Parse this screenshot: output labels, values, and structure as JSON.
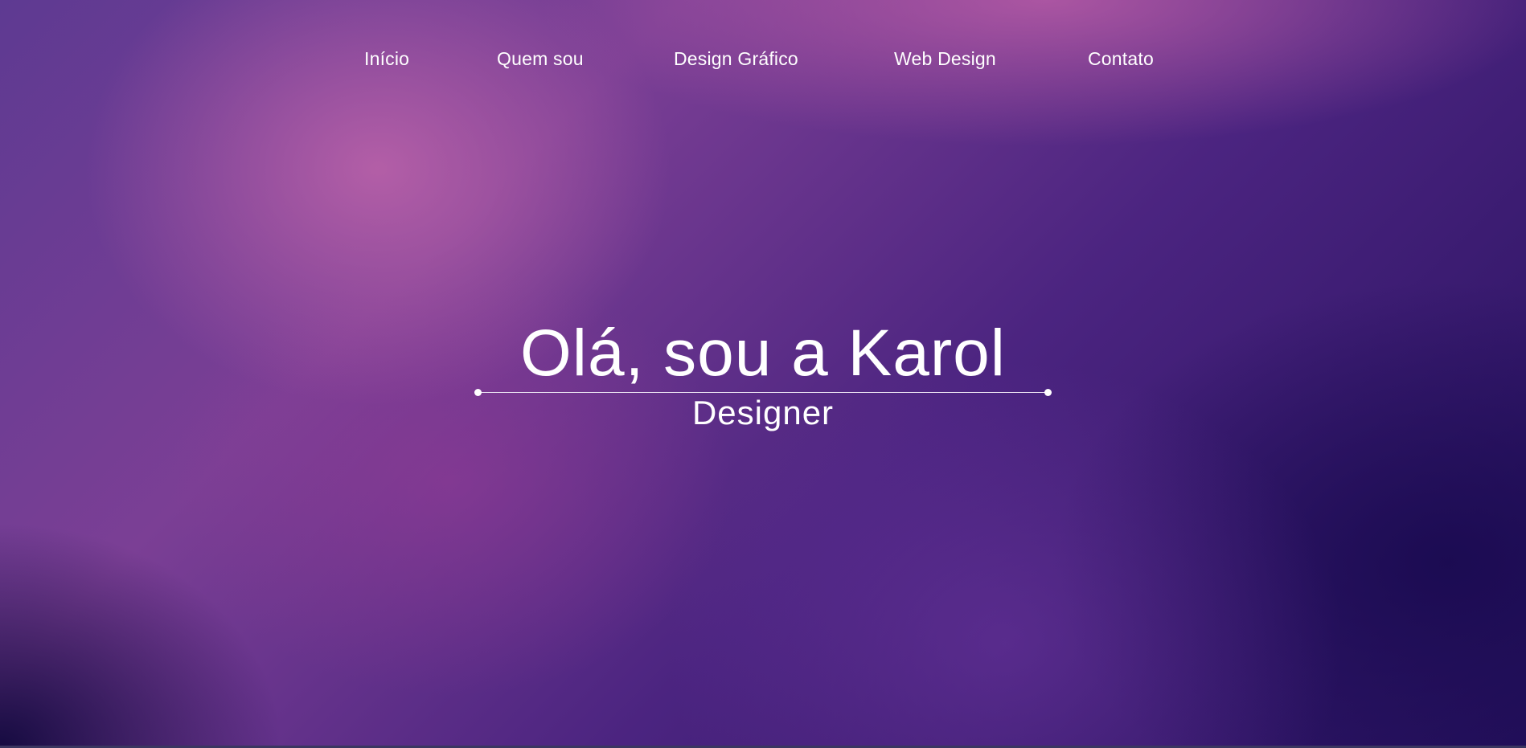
{
  "nav": {
    "items": [
      {
        "label": "Início"
      },
      {
        "label": "Quem sou"
      },
      {
        "label": "Design Gráfico"
      },
      {
        "label": "Web Design"
      },
      {
        "label": "Contato"
      }
    ]
  },
  "hero": {
    "title": "Olá, sou a Karol",
    "subtitle": "Designer"
  },
  "colors": {
    "text": "#ffffff",
    "background_dark": "#24105c",
    "background_accent": "#b862a8"
  }
}
